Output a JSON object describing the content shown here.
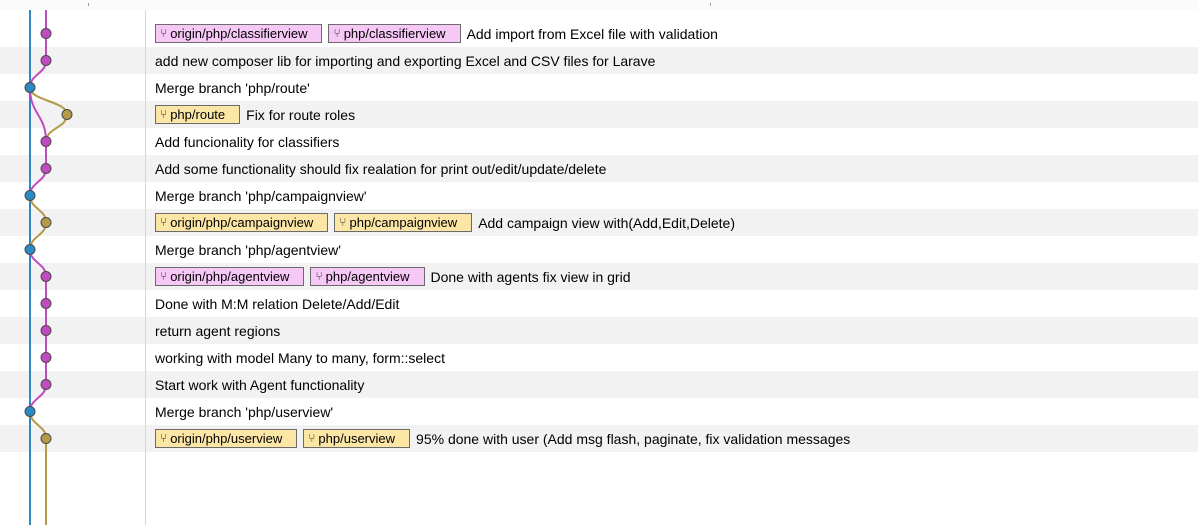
{
  "colors": {
    "main_line": "#2b8ac4",
    "purple_line": "#c04bc0",
    "olive_line": "#b59a48",
    "pink_tag": "#f6c8f6",
    "yellow_tag": "#fbe6a6"
  },
  "branch_icon": "git-branch-icon",
  "commits": [
    {
      "message": "Add import from Excel file with validation",
      "tags": [
        {
          "label": "origin/php/classifierview",
          "color": "pink"
        },
        {
          "label": "php/classifierview",
          "color": "pink"
        }
      ]
    },
    {
      "message": "add new composer lib for importing and exporting Excel and CSV files for Larave",
      "tags": []
    },
    {
      "message": "Merge branch 'php/route'",
      "tags": []
    },
    {
      "message": "Fix for route roles",
      "tags": [
        {
          "label": "php/route",
          "color": "yellow"
        }
      ]
    },
    {
      "message": "Add funcionality for classifiers",
      "tags": []
    },
    {
      "message": "Add some functionality should fix realation for print out/edit/update/delete",
      "tags": []
    },
    {
      "message": "Merge branch 'php/campaignview'",
      "tags": []
    },
    {
      "message": "Add campaign view with(Add,Edit,Delete)",
      "tags": [
        {
          "label": "origin/php/campaignview",
          "color": "yellow"
        },
        {
          "label": "php/campaignview",
          "color": "yellow"
        }
      ]
    },
    {
      "message": "Merge branch 'php/agentview'",
      "tags": []
    },
    {
      "message": "Done with agents fix view in grid",
      "tags": [
        {
          "label": "origin/php/agentview",
          "color": "pink"
        },
        {
          "label": "php/agentview",
          "color": "pink"
        }
      ]
    },
    {
      "message": "Done with M:M relation Delete/Add/Edit",
      "tags": []
    },
    {
      "message": "return agent regions",
      "tags": []
    },
    {
      "message": "working with model Many to many, form::select",
      "tags": []
    },
    {
      "message": "Start work with Agent functionality",
      "tags": []
    },
    {
      "message": "Merge branch 'php/userview'",
      "tags": []
    },
    {
      "message": "95% done with user (Add msg flash, paginate, fix validation messages",
      "tags": [
        {
          "label": "origin/php/userview",
          "color": "yellow"
        },
        {
          "label": "php/userview",
          "color": "yellow"
        }
      ]
    }
  ]
}
